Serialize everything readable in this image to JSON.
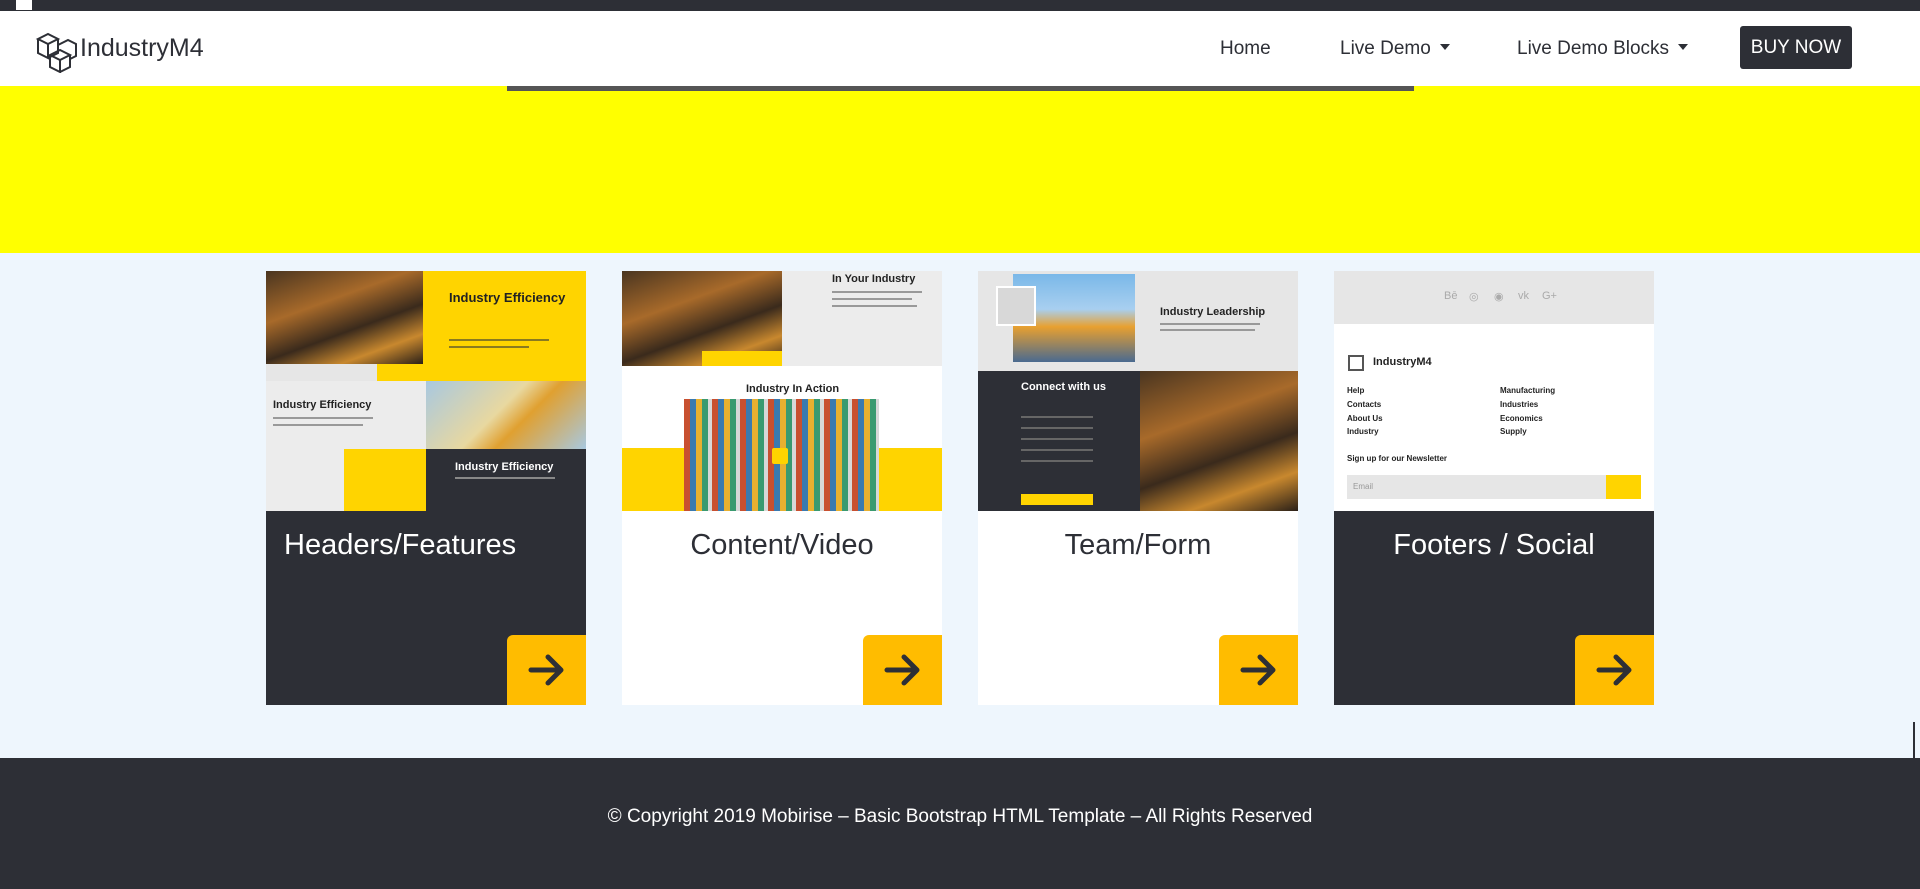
{
  "brand": {
    "name": "IndustryM4",
    "logo_icon": "cubes-logo-icon"
  },
  "nav": {
    "home": "Home",
    "live_demo": "Live Demo",
    "live_demo_blocks": "Live Demo Blocks",
    "buy_now": "BUY NOW"
  },
  "cards": [
    {
      "title": "Headers/Features",
      "theme": "dark",
      "thumb": {
        "heading": "Industry Efficiency",
        "sub_heading": "Industry Efficiency",
        "dark_heading": "Industry Efficiency"
      }
    },
    {
      "title": "Content/Video",
      "theme": "light",
      "thumb": {
        "top_heading": "In Your Industry",
        "section_heading": "Industry In Action"
      }
    },
    {
      "title": "Team/Form",
      "theme": "light",
      "thumb": {
        "heading": "Industry Leadership",
        "form_heading": "Connect with us"
      }
    },
    {
      "title": "Footers / Social",
      "theme": "dark",
      "thumb": {
        "social": [
          "Bē",
          "◎",
          "◉",
          "vk",
          "G+"
        ],
        "brand": "IndustryM4",
        "links_left": [
          "Help",
          "Contacts",
          "About Us",
          "Industry"
        ],
        "links_right": [
          "Manufacturing",
          "Industries",
          "Economics",
          "Supply"
        ],
        "newsletter": "Sign up for our Newsletter",
        "email_placeholder": "Email"
      }
    }
  ],
  "footer": {
    "copyright": "© Copyright 2019 Mobirise – Basic Bootstrap HTML Template – All Rights Reserved"
  },
  "colors": {
    "dark": "#2d2f36",
    "accent": "#ffbc00",
    "band": "#ffff00",
    "background": "#eef6fd"
  }
}
